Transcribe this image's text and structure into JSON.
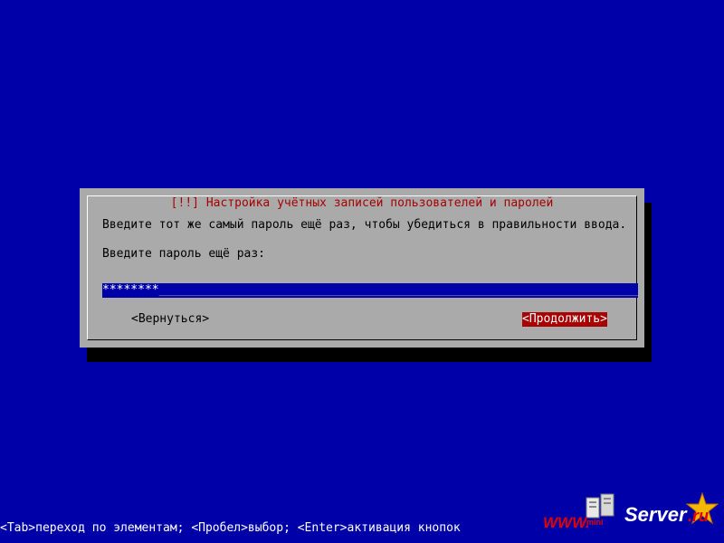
{
  "dialog": {
    "title": "[!!] Настройка учётных записей пользователей и паролей",
    "description": "Введите тот же самый пароль ещё раз, чтобы убедиться в правильности ввода.",
    "prompt": "Введите пароль ещё раз:",
    "password_masked": "********",
    "password_fill": "__________________________________________________________________________",
    "back_label": "<Вернуться>",
    "continue_label": "<Продолжить>"
  },
  "help_bar": {
    "text": "<Tab>переход по элементам; <Пробел>выбор; <Enter>активация кнопок"
  },
  "watermark": {
    "www": "WWW.",
    "mini": "mini",
    "server": "Server",
    "ru": ".ru"
  },
  "colors": {
    "background": "#0000a8",
    "dialog": "#aaaaaa",
    "title": "#a80000",
    "selected_button": "#a80000"
  }
}
